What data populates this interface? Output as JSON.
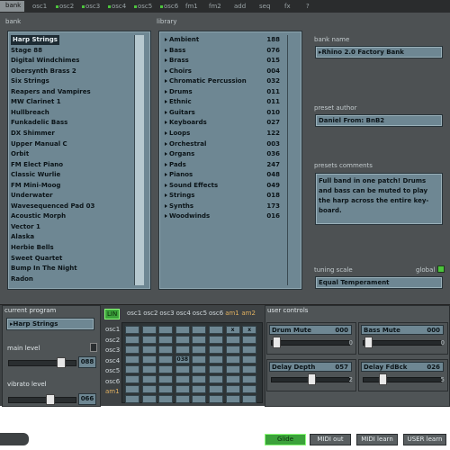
{
  "tabs": [
    {
      "label": "bank",
      "active": true,
      "dot": false
    },
    {
      "label": "osc1",
      "active": false,
      "dot": false
    },
    {
      "label": "osc2",
      "active": false,
      "dot": true
    },
    {
      "label": "osc3",
      "active": false,
      "dot": true
    },
    {
      "label": "osc4",
      "active": false,
      "dot": true
    },
    {
      "label": "osc5",
      "active": false,
      "dot": true
    },
    {
      "label": "osc6",
      "active": false,
      "dot": true
    },
    {
      "label": "fm1",
      "active": false,
      "dot": false
    },
    {
      "label": "fm2",
      "active": false,
      "dot": false
    },
    {
      "label": "add",
      "active": false,
      "dot": false
    },
    {
      "label": "seq",
      "active": false,
      "dot": false
    },
    {
      "label": "fx",
      "active": false,
      "dot": false
    },
    {
      "label": "?",
      "active": false,
      "dot": false
    }
  ],
  "bank": {
    "label": "bank",
    "items": [
      "Harp Strings",
      "Stage 88",
      "Digital Windchimes",
      "Obersynth Brass 2",
      "Six Strings",
      "Reapers and Vampires",
      "MW Clarinet 1",
      "Hullbreach",
      "Funkadelic Bass",
      "DX Shimmer",
      "Upper Manual C",
      "Orbit",
      "FM Elect Piano",
      "Classic Wurlie",
      "FM Mini-Moog",
      "Underwater",
      "Wavesequenced Pad 03",
      "Acoustic Morph",
      "Vector 1",
      "Alaska",
      "Herbie Bells",
      "Sweet Quartet",
      "Bump In The Night",
      "Radon"
    ],
    "selected_index": 0
  },
  "library": {
    "label": "library",
    "items": [
      {
        "name": "Ambient",
        "count": "188"
      },
      {
        "name": "Bass",
        "count": "076"
      },
      {
        "name": "Brass",
        "count": "015"
      },
      {
        "name": "Choirs",
        "count": "004"
      },
      {
        "name": "Chromatic Percussion",
        "count": "032"
      },
      {
        "name": "Drums",
        "count": "011"
      },
      {
        "name": "Ethnic",
        "count": "011"
      },
      {
        "name": "Guitars",
        "count": "010"
      },
      {
        "name": "Keyboards",
        "count": "027"
      },
      {
        "name": "Loops",
        "count": "122"
      },
      {
        "name": "Orchestral",
        "count": "003"
      },
      {
        "name": "Organs",
        "count": "036"
      },
      {
        "name": "Pads",
        "count": "247"
      },
      {
        "name": "Pianos",
        "count": "048"
      },
      {
        "name": "Sound Effects",
        "count": "049"
      },
      {
        "name": "Strings",
        "count": "018"
      },
      {
        "name": "Synths",
        "count": "173"
      },
      {
        "name": "Woodwinds",
        "count": "016"
      }
    ]
  },
  "bank_name": {
    "label": "bank name",
    "value": "Rhino 2.0 Factory Bank"
  },
  "preset_author": {
    "label": "preset author",
    "value": "Daniel   From: BnB2"
  },
  "presets_comments": {
    "label": "presets comments",
    "value": "Full band in one patch! Drums and bass can be muted to play the harp across the entire key-board."
  },
  "tuning_scale": {
    "label": "tuning scale",
    "value": "Equal Temperament",
    "global_label": "global",
    "global_color": "#4cc43c"
  },
  "current_program": {
    "label": "current program",
    "value": "Harp Strings"
  },
  "main_level": {
    "label": "main level",
    "value": "088"
  },
  "vibrato_level": {
    "label": "vibrato level",
    "value": "066"
  },
  "matrix": {
    "lin_label": "LIN",
    "columns": [
      "osc1",
      "osc2",
      "osc3",
      "osc4",
      "osc5",
      "osc6",
      "am1",
      "am2"
    ],
    "rows": [
      "osc1",
      "osc2",
      "osc3",
      "osc4",
      "osc5",
      "osc6",
      "am1"
    ],
    "cell_values": [
      {
        "row": 0,
        "col": 6,
        "text": "x"
      },
      {
        "row": 0,
        "col": 7,
        "text": "x"
      },
      {
        "row": 3,
        "col": 3,
        "text": "038"
      }
    ]
  },
  "user_controls": {
    "label": "user controls",
    "items": [
      {
        "name": "Drum Mute",
        "value": "000",
        "knob": "0"
      },
      {
        "name": "Bass Mute",
        "value": "000",
        "knob": "0"
      },
      {
        "name": "Delay Depth",
        "value": "057",
        "knob": "2"
      },
      {
        "name": "Delay FdBck",
        "value": "026",
        "knob": "5"
      }
    ]
  },
  "bottom_buttons": [
    {
      "label": "Glide",
      "active": true
    },
    {
      "label": "MIDI out",
      "active": false
    },
    {
      "label": "MIDI learn",
      "active": false
    },
    {
      "label": "USER learn",
      "active": false
    }
  ],
  "colors": {
    "accent_green": "#4cc43c",
    "panel": "#6e8793",
    "background": "#4d5153"
  }
}
